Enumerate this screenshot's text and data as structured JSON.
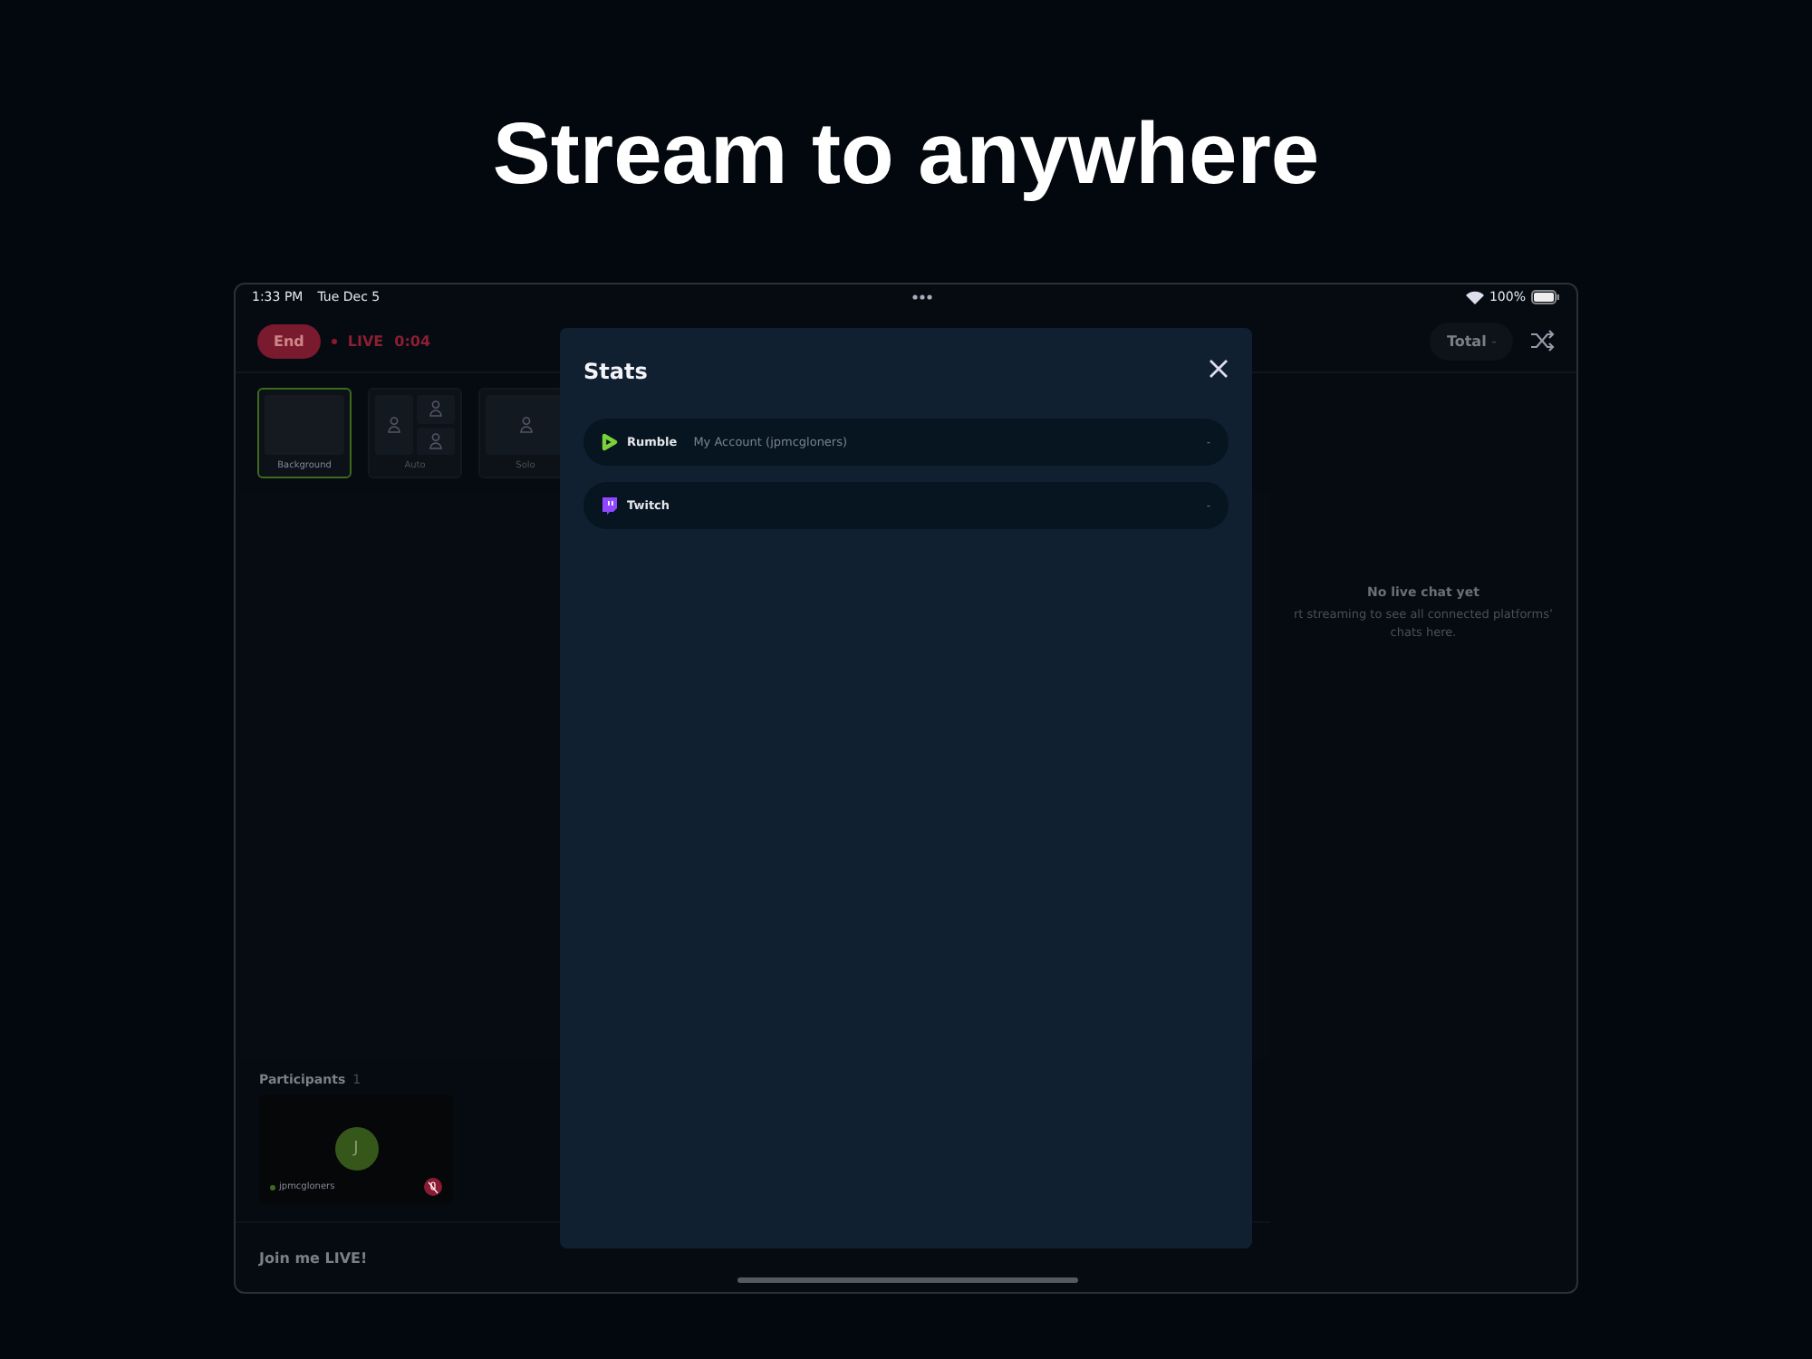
{
  "headline": "Stream to anywhere",
  "status_bar": {
    "time": "1:33 PM",
    "date": "Tue Dec 5",
    "battery": "100%"
  },
  "top_bar": {
    "end_button": "End",
    "live_label": "LIVE",
    "timer": "0:04"
  },
  "layouts": [
    {
      "label": "Background",
      "kind": "background",
      "selected": true
    },
    {
      "label": "Auto",
      "kind": "auto",
      "selected": false
    },
    {
      "label": "Solo",
      "kind": "solo",
      "selected": false
    }
  ],
  "participants": {
    "title": "Participants",
    "count": "1",
    "items": [
      {
        "initial": "J",
        "name": "jpmcgloners",
        "muted": true
      }
    ]
  },
  "footer": {
    "title": "Join me LIVE!"
  },
  "chat": {
    "total_label": "Total",
    "total_value": "-",
    "empty_title": "No live chat yet",
    "empty_text": "rt streaming to see all connected platforms’ chats here."
  },
  "modal": {
    "title": "Stats",
    "rows": [
      {
        "kind": "rumble",
        "platform": "Rumble",
        "account": "My Account (jpmcgloners)",
        "value": "-"
      },
      {
        "kind": "twitch",
        "platform": "Twitch",
        "value": "-"
      }
    ]
  }
}
